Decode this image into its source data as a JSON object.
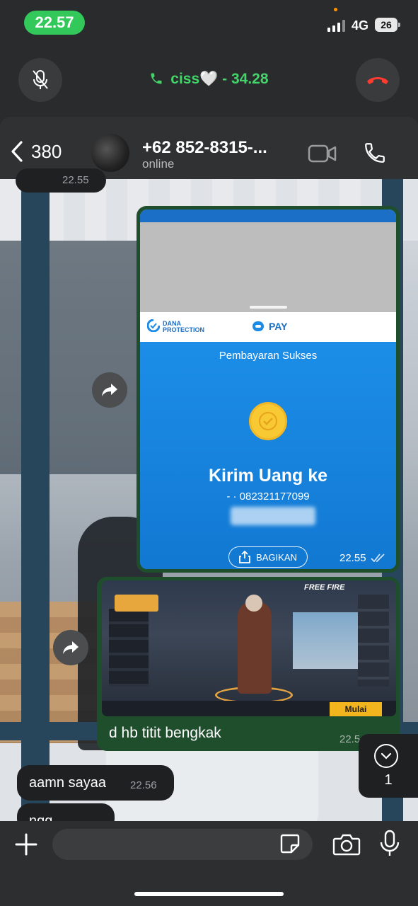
{
  "status_bar": {
    "time": "22.57",
    "network": "4G",
    "battery": "26"
  },
  "call_bar": {
    "title": "ciss🤍 - 34.28"
  },
  "chat_header": {
    "unread_count": "380",
    "contact_name": "+62 852-8315-...",
    "contact_status": "online"
  },
  "messages": {
    "top_partial_time": "22.55",
    "dana_card": {
      "brand_protection_line1": "DANA",
      "brand_protection_line2": "PROTECTION",
      "brand_pay": "PAY",
      "success_label": "Pembayaran Sukses",
      "title": "Kirim Uang ke",
      "account": "- · 082321177099",
      "share_label": "BAGIKAN",
      "time": "22.55"
    },
    "game_card": {
      "logo_text": "FREE FIRE",
      "start_button": "Mulai",
      "caption": "d hb titit bengkak",
      "time": "22.5"
    },
    "incoming_1": {
      "text": "aamn sayaa",
      "time": "22.56"
    },
    "incoming_2": {
      "text": "ngg"
    }
  },
  "scroll_badge": {
    "count": "1"
  },
  "colors": {
    "call_green": "#43d46a",
    "time_pill_green": "#32c85a",
    "outgoing_bubble": "#1f4e2d",
    "end_call_red": "#ff3b30",
    "dana_blue": "#1a8ae6"
  },
  "icons": [
    "mic-off-icon",
    "phone-icon",
    "end-call-icon",
    "back-chevron-icon",
    "video-call-icon",
    "voice-call-icon",
    "forward-icon",
    "share-icon",
    "chevron-down-icon",
    "plus-icon",
    "sticker-icon",
    "camera-icon",
    "mic-icon"
  ]
}
